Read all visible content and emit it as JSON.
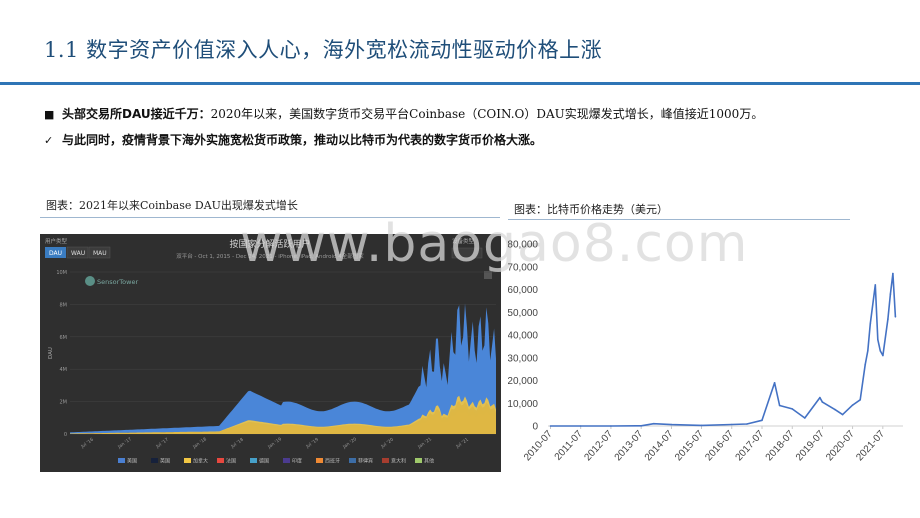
{
  "title": "1.1 数字资产价值深入人心，海外宽松流动性驱动价格上涨",
  "bullets": [
    {
      "marker": "■",
      "bold": "头部交易所DAU接近千万：",
      "text": "2020年以来，美国数字货币交易平台Coinbase（COIN.O）DAU实现爆发式增长，峰值接近1000万。"
    },
    {
      "marker": "✓",
      "bold": "与此同时，疫情背景下海外实施宽松货币政策，推动以比特币为代表的数字货币价格大涨。",
      "text": ""
    }
  ],
  "figure1": {
    "caption": "图表：2021年以来Coinbase DAU出现爆发式增长",
    "panel": {
      "user_type_label": "用户类型",
      "tabs": [
        "DAU",
        "WAU",
        "MAU"
      ],
      "device_label": "设备类型",
      "chart_title": "按国家分解活跃用户",
      "subtitle": "双平台 - Oct 1, 2015 - Dec 24, 2021 - iPhone, iPad, Android 4全部国家",
      "logo": "SensorTower",
      "y_axis_label": "DAU",
      "y_ticks": [
        "10M",
        "8M",
        "6M",
        "4M",
        "2M",
        "0"
      ],
      "x_ticks": [
        "Jul '16",
        "Jan '17",
        "Jul '17",
        "Jan '18",
        "Jul '18",
        "Jan '19",
        "Jul '19",
        "Jan '20",
        "Jul '20",
        "Jan '21",
        "Jul '21"
      ],
      "legend": [
        "美国",
        "英国",
        "加拿大",
        "法国",
        "德国",
        "印度",
        "西班牙",
        "菲律宾",
        "意大利",
        "其他"
      ],
      "legend_colors": [
        "#4a7fd1",
        "#16213b",
        "#f2c744",
        "#e8483f",
        "#46a0c9",
        "#4b3b8f",
        "#f08a34",
        "#3c6da6",
        "#a63d2f",
        "#9fc96b"
      ],
      "colors": {
        "bg": "#2f2f2f",
        "area": "#4a86d8",
        "other": "#a7d375",
        "grid": "#4a4a4a"
      }
    }
  },
  "figure2": {
    "caption": "图表：比特币价格走势（美元）",
    "chart_data": {
      "type": "line",
      "title": "",
      "xlabel": "",
      "ylabel": "",
      "ylim": [
        0,
        80000
      ],
      "y_ticks": [
        0,
        10000,
        20000,
        30000,
        40000,
        50000,
        60000,
        70000,
        80000
      ],
      "x_ticks": [
        "2010-07",
        "2011-07",
        "2012-07",
        "2013-07",
        "2014-07",
        "2015-07",
        "2016-07",
        "2017-07",
        "2018-07",
        "2019-07",
        "2020-07",
        "2021-07"
      ],
      "grid": false,
      "series": [
        {
          "name": "",
          "color": "#4472c4",
          "x": [
            "2010-07",
            "2011-07",
            "2012-07",
            "2013-07",
            "2013-12",
            "2014-07",
            "2015-07",
            "2016-07",
            "2017-01",
            "2017-07",
            "2017-12",
            "2018-02",
            "2018-07",
            "2018-12",
            "2019-06",
            "2019-07",
            "2019-12",
            "2020-03",
            "2020-07",
            "2020-10",
            "2020-12",
            "2021-01",
            "2021-02",
            "2021-04",
            "2021-05",
            "2021-06",
            "2021-07",
            "2021-09",
            "2021-10",
            "2021-11",
            "2021-12"
          ],
          "values": [
            0,
            15,
            7,
            90,
            1000,
            600,
            280,
            650,
            900,
            2500,
            19000,
            9000,
            7500,
            3500,
            12500,
            10500,
            7200,
            5000,
            9200,
            11500,
            27000,
            33000,
            45000,
            62000,
            38000,
            33000,
            31000,
            47000,
            58000,
            67000,
            48000
          ]
        }
      ]
    }
  },
  "watermark": "www.baogao8.com"
}
